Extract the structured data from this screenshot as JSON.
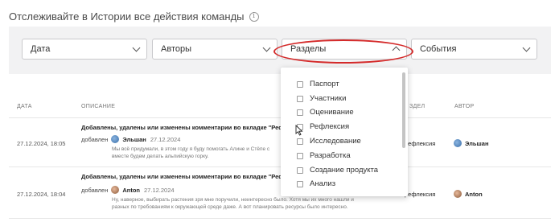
{
  "page": {
    "title": "Отслеживайте в Истории все действия команды",
    "info_icon": "info-icon"
  },
  "filters": {
    "date": "Дата",
    "authors": "Авторы",
    "sections": "Разделы",
    "events": "События"
  },
  "table": {
    "headers": {
      "date": "ДАТА",
      "description": "ОПИСАНИЕ",
      "section": "ЗДЕЛ",
      "author": "АВТОР"
    },
    "rows": [
      {
        "date": "27.12.2024, 18:05",
        "title": "Добавлены, удалены или изменены комментарии во вкладке \"Рефлексия\"",
        "verb": "добавлен",
        "user": "Эльшан",
        "user_date": "27.12.2024",
        "comment_line1": "Мы всё придумали, в этом году я буду помогать Алине и Стёпе с",
        "comment_line2": "вместе будем делать альпийскую горку.",
        "section": "рефлексия",
        "author": "Эльшан"
      },
      {
        "date": "27.12.2024, 18:04",
        "title": "Добавлены, удалены или изменены комментарии во вкладке \"Рефлексия\"",
        "verb": "добавлен",
        "user": "Anton",
        "user_date": "27.12.2024",
        "comment_line1": "Ну, наверное, выбирать растения зря мне поручили, неинтересно было. Хотя мы их много нашли и",
        "comment_line2": "разных по требованиям к окружающей среде даже. А вот планировать ресурсы было интересно.",
        "section": "рефлексия",
        "author": "Anton"
      }
    ]
  },
  "dropdown": {
    "items": [
      {
        "label": "Паспорт",
        "checked": false
      },
      {
        "label": "Участники",
        "checked": false
      },
      {
        "label": "Оценивание",
        "checked": false
      },
      {
        "label": "Рефлексия",
        "checked": false
      },
      {
        "label": "Исследование",
        "checked": false
      },
      {
        "label": "Разработка",
        "checked": false
      },
      {
        "label": "Создание продукта",
        "checked": false
      },
      {
        "label": "Анализ",
        "checked": false
      }
    ]
  },
  "colors": {
    "highlight": "#d42a2a",
    "panel": "#f2f2f3"
  }
}
